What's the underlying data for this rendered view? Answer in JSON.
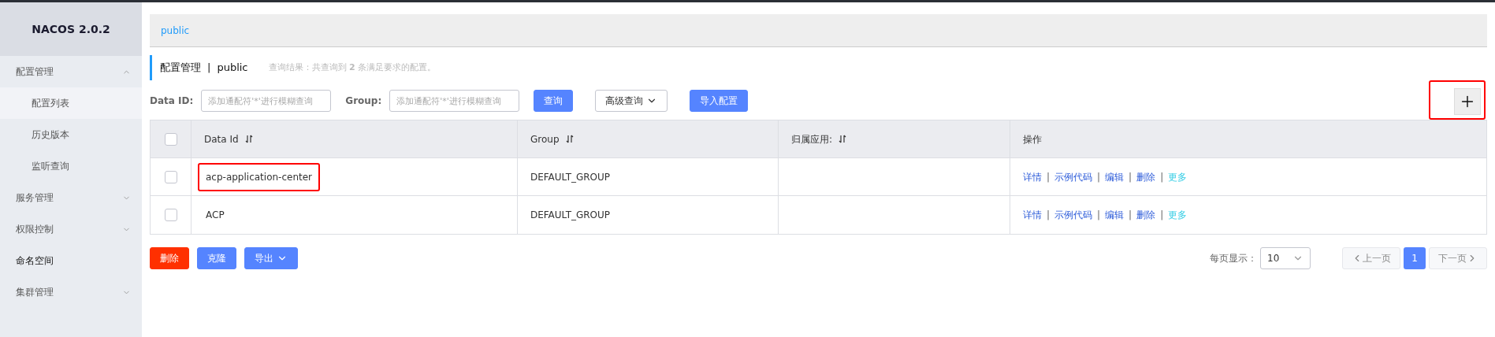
{
  "sidebar": {
    "title": "NACOS 2.0.2",
    "items": [
      {
        "label": "配置管理",
        "kind": "group",
        "expanded": true,
        "children": [
          {
            "label": "配置列表",
            "selected": true
          },
          {
            "label": "历史版本",
            "selected": false
          },
          {
            "label": "监听查询",
            "selected": false
          }
        ]
      },
      {
        "label": "服务管理",
        "kind": "group",
        "expanded": false
      },
      {
        "label": "权限控制",
        "kind": "group",
        "expanded": false
      },
      {
        "label": "命名空间",
        "kind": "link"
      },
      {
        "label": "集群管理",
        "kind": "group",
        "expanded": false
      }
    ]
  },
  "namespace_tabs": [
    {
      "label": "public",
      "selected": true
    }
  ],
  "header": {
    "title": "配置管理",
    "separator": "|",
    "namespace": "public",
    "result": "查询结果：共查询到 **2** 条满足要求的配置。"
  },
  "filters": [
    {
      "label": "Data ID:",
      "placeholder": "添加通配符'*'进行模糊查询"
    },
    {
      "label": "Group:",
      "placeholder": "添加通配符'*'进行模糊查询"
    }
  ],
  "toolbar_buttons": [
    {
      "label": "查询",
      "kind": "primary",
      "dropdown": false
    },
    {
      "label": "高级查询",
      "kind": "outline",
      "dropdown": true
    },
    {
      "label": "导入配置",
      "kind": "primary",
      "dropdown": false
    }
  ],
  "add_button": {
    "highlighted": true
  },
  "table": {
    "select_all": {
      "checked": false
    },
    "columns": [
      {
        "label": "Data Id",
        "sortable": true
      },
      {
        "label": "Group",
        "sortable": true
      },
      {
        "label": "归属应用:",
        "sortable": true
      },
      {
        "label": "操作",
        "sortable": false
      }
    ],
    "action_separator": "|",
    "rows": [
      {
        "checked": false,
        "data_id": "acp-application-center",
        "highlighted": true,
        "group": "DEFAULT_GROUP",
        "actions": [
          {
            "label": "详情",
            "kind": "link"
          },
          {
            "label": "示例代码",
            "kind": "link"
          },
          {
            "label": "编辑",
            "kind": "link"
          },
          {
            "label": "删除",
            "kind": "link"
          },
          {
            "label": "更多",
            "kind": "more"
          }
        ]
      },
      {
        "checked": false,
        "data_id": "ACP",
        "highlighted": false,
        "group": "DEFAULT_GROUP",
        "actions": [
          {
            "label": "详情",
            "kind": "link"
          },
          {
            "label": "示例代码",
            "kind": "link"
          },
          {
            "label": "编辑",
            "kind": "link"
          },
          {
            "label": "删除",
            "kind": "link"
          },
          {
            "label": "更多",
            "kind": "more"
          }
        ]
      }
    ]
  },
  "bottom_buttons": [
    {
      "label": "删除",
      "kind": "danger",
      "dropdown": false
    },
    {
      "label": "克隆",
      "kind": "primary",
      "dropdown": false
    },
    {
      "label": "导出",
      "kind": "primary",
      "dropdown": true
    }
  ],
  "pagination": {
    "page_size_label": "每页显示：",
    "page_size": "10",
    "prev": {
      "label": "上一页",
      "disabled": true
    },
    "pages": [
      {
        "label": "1",
        "selected": true
      }
    ],
    "next": {
      "label": "下一页",
      "disabled": true
    }
  }
}
